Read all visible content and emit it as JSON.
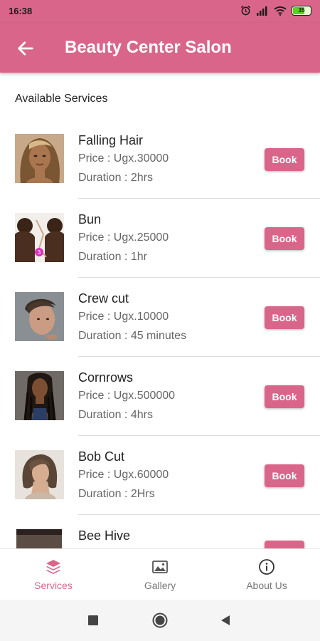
{
  "status": {
    "time": "16:38",
    "battery": "35"
  },
  "appbar": {
    "title": "Beauty Center Salon"
  },
  "section_title": "Available Services",
  "services": [
    {
      "name": "Falling Hair",
      "price": "Price : Ugx.30000",
      "duration": "Duration : 2hrs",
      "book": "Book"
    },
    {
      "name": "Bun",
      "price": "Price : Ugx.25000",
      "duration": "Duration : 1hr",
      "book": "Book"
    },
    {
      "name": "Crew cut",
      "price": "Price : Ugx.10000",
      "duration": "Duration : 45 minutes",
      "book": "Book"
    },
    {
      "name": "Cornrows",
      "price": "Price : Ugx.500000",
      "duration": "Duration : 4hrs",
      "book": "Book"
    },
    {
      "name": "Bob Cut",
      "price": "Price : Ugx.60000",
      "duration": "Duration : 2Hrs",
      "book": "Book"
    },
    {
      "name": "Bee Hive",
      "price": "",
      "duration": "",
      "book": ""
    }
  ],
  "bottom_nav": [
    {
      "label": "Services",
      "icon": "layers-icon",
      "active": true
    },
    {
      "label": "Gallery",
      "icon": "image-icon",
      "active": false
    },
    {
      "label": "About Us",
      "icon": "info-icon",
      "active": false
    }
  ],
  "colors": {
    "primary": "#d9668a",
    "text": "#222222",
    "muted": "#666666"
  }
}
